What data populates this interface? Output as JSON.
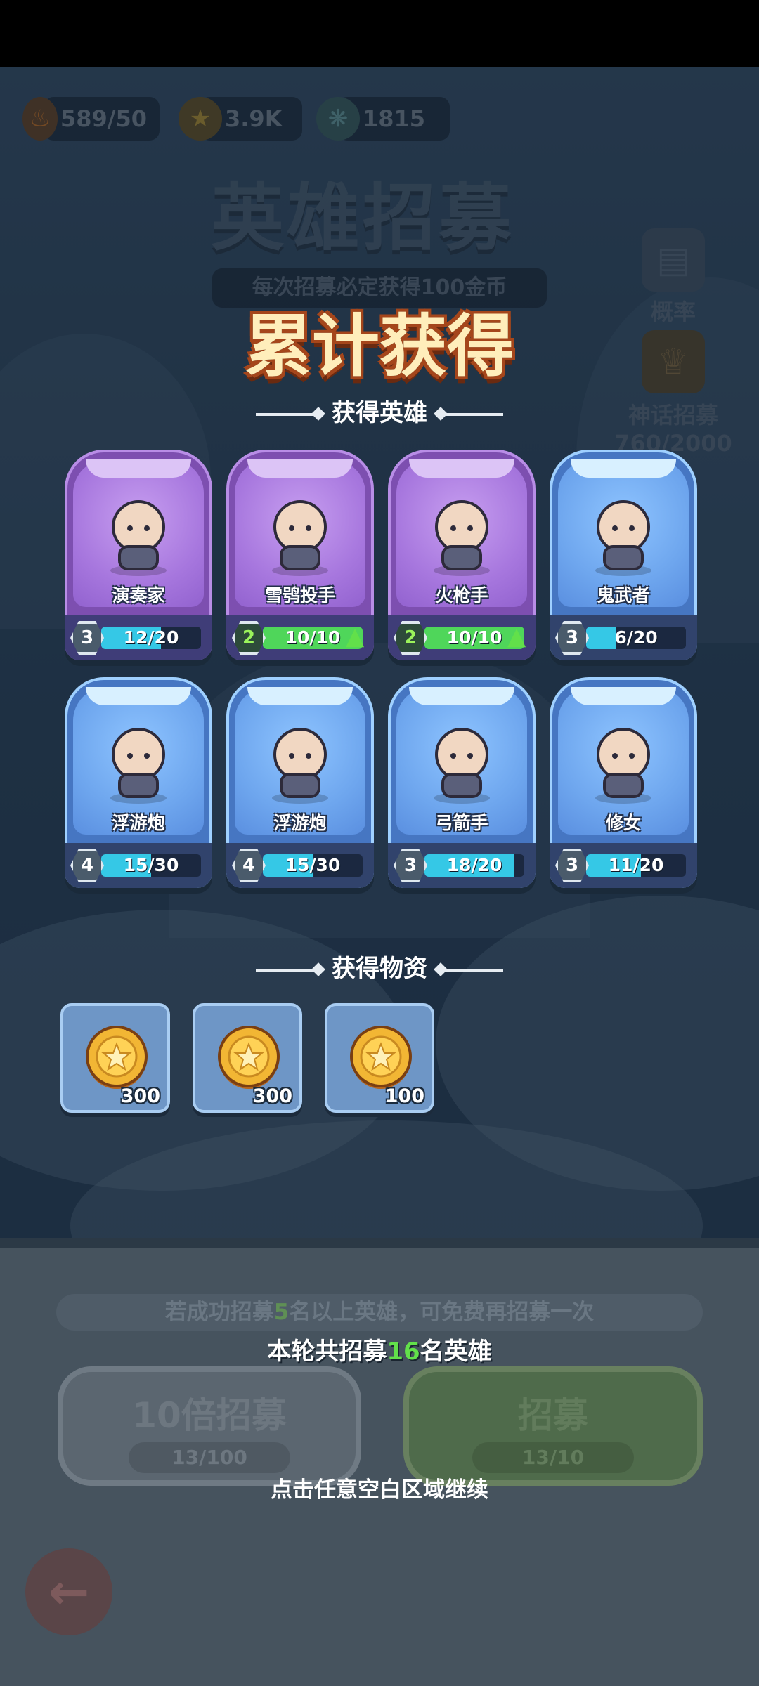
{
  "resources": [
    {
      "icon": "fire-energy-icon",
      "value": "589/50"
    },
    {
      "icon": "gold-coin-icon",
      "value": "3.9K"
    },
    {
      "icon": "crystal-icon",
      "value": "1815"
    }
  ],
  "background": {
    "title": "英雄招募",
    "subtitle": "每次招募必定获得100金币",
    "side_buttons": [
      {
        "icon": "probability-doc-icon",
        "label": "概率"
      },
      {
        "icon": "myth-badge-icon",
        "label": "神话招募",
        "progress": "760/2000"
      }
    ],
    "hint": {
      "prefix": "若成功招募",
      "count": "5",
      "suffix": "名以上英雄，可免费再招募一次"
    },
    "ten_button": {
      "label": "10倍招募",
      "cost": "13/100"
    },
    "one_button": {
      "label": "招募",
      "cost": "13/10"
    }
  },
  "popup": {
    "title": "累计获得",
    "heroes_header": "获得英雄",
    "items_header": "获得物资",
    "heroes": [
      {
        "name": "演奏家",
        "rarity": "epic",
        "level": "3",
        "progress": "12/20",
        "fill": 0.6,
        "upgrade": false
      },
      {
        "name": "雪鸮投手",
        "rarity": "epic",
        "level": "2",
        "progress": "10/10",
        "fill": 1.0,
        "upgrade": true
      },
      {
        "name": "火枪手",
        "rarity": "epic",
        "level": "2",
        "progress": "10/10",
        "fill": 1.0,
        "upgrade": true
      },
      {
        "name": "鬼武者",
        "rarity": "rare",
        "level": "3",
        "progress": "6/20",
        "fill": 0.3,
        "upgrade": false
      },
      {
        "name": "浮游炮",
        "rarity": "rare",
        "level": "4",
        "progress": "15/30",
        "fill": 0.5,
        "upgrade": false
      },
      {
        "name": "浮游炮",
        "rarity": "rare",
        "level": "4",
        "progress": "15/30",
        "fill": 0.5,
        "upgrade": false
      },
      {
        "name": "弓箭手",
        "rarity": "rare",
        "level": "3",
        "progress": "18/20",
        "fill": 0.9,
        "upgrade": false
      },
      {
        "name": "修女",
        "rarity": "rare",
        "level": "3",
        "progress": "11/20",
        "fill": 0.55,
        "upgrade": false
      }
    ],
    "items": [
      {
        "icon": "gold-coin-icon",
        "qty": "300"
      },
      {
        "icon": "gold-coin-icon",
        "qty": "300"
      },
      {
        "icon": "gold-coin-icon",
        "qty": "100"
      }
    ],
    "result": {
      "prefix": "本轮共招募",
      "count": "16",
      "suffix": "名英雄"
    },
    "continue": "点击任意空白区域继续"
  },
  "colors": {
    "epic": "#7d4fb0",
    "rare": "#4676c2",
    "progress": "#35c8e6",
    "full": "#4fd65a",
    "accent_green": "#62e04a"
  }
}
